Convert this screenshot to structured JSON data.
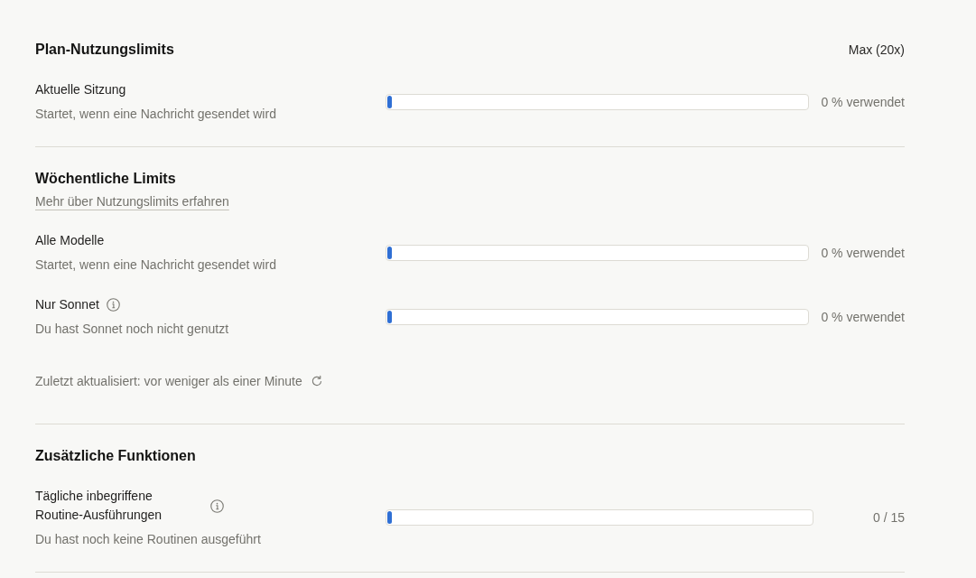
{
  "sections": [
    {
      "title": "Plan-Nutzungslimits",
      "plan": "Max (20x)",
      "rows": [
        {
          "label": "Aktuelle Sitzung",
          "has_info": false,
          "description": "Startet, wenn eine Nachricht gesendet wird",
          "level": 0,
          "reading": "0 % verwendet"
        }
      ]
    },
    {
      "title": "Wöchentliche Limits",
      "link": "Mehr über Nutzungslimits erfahren",
      "rows": [
        {
          "label": "Alle Modelle",
          "has_info": false,
          "description": "Startet, wenn eine Nachricht gesendet wird",
          "level": 0,
          "reading": "0 % verwendet"
        },
        {
          "label": "Nur Sonnet",
          "has_info": true,
          "description": "Du hast Sonnet noch nicht genutzt",
          "level": 0,
          "reading": "0 % verwendet"
        }
      ],
      "updated": "Zuletzt aktualisiert: vor weniger als einer Minute"
    },
    {
      "title": "Zusätzliche Funktionen",
      "rows": [
        {
          "label": "Tägliche inbegriffene Routine-Ausführungen",
          "has_info": true,
          "description": "Du hast noch keine Routinen ausgeführt",
          "level": 0,
          "reading": "0 / 15"
        }
      ]
    }
  ]
}
